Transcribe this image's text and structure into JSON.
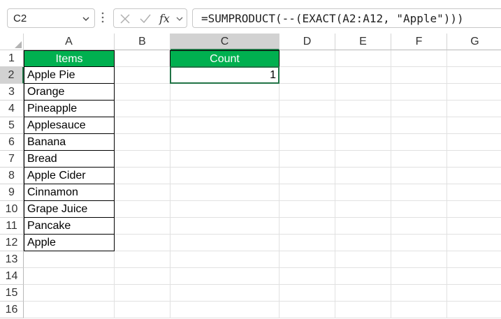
{
  "name_box": {
    "value": "C2"
  },
  "formula_bar": {
    "formula": "=SUMPRODUCT(--(EXACT(A2:A12, \"Apple\")))"
  },
  "icons": {
    "cancel": "close-icon",
    "enter": "check-icon",
    "function": "fx-icon",
    "expand": "chevron-down-icon"
  },
  "columns": [
    "A",
    "B",
    "C",
    "D",
    "E",
    "F",
    "G"
  ],
  "rows": [
    "1",
    "2",
    "3",
    "4",
    "5",
    "6",
    "7",
    "8",
    "9",
    "10",
    "11",
    "12",
    "13",
    "14",
    "15",
    "16"
  ],
  "table_items": {
    "header": "Items",
    "values": [
      "Apple Pie",
      "Orange",
      "Pineapple",
      "Applesauce",
      "Banana",
      "Bread",
      "Apple Cider",
      "Cinnamon",
      "Grape Juice",
      "Pancake",
      "Apple"
    ]
  },
  "table_count": {
    "header": "Count",
    "value": "1"
  },
  "colors": {
    "header_fill": "#00b050",
    "header_text": "#ffffff",
    "selection": "#217346"
  }
}
